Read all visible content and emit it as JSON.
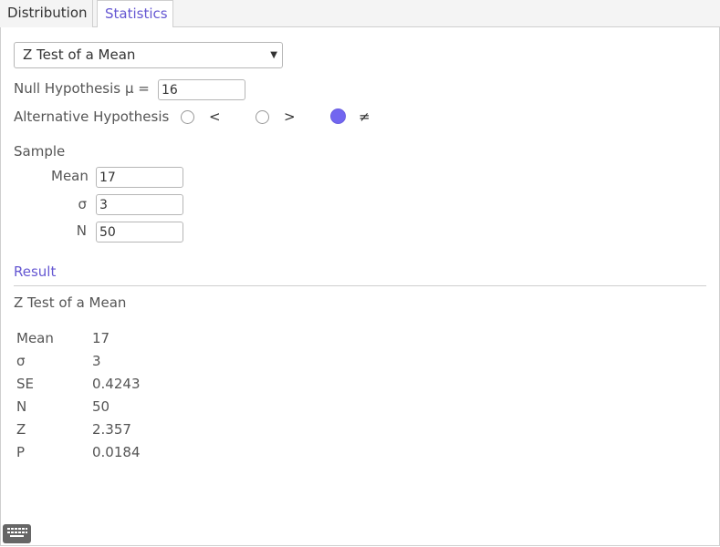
{
  "tabs": [
    {
      "label": "Distribution",
      "active": false
    },
    {
      "label": "Statistics",
      "active": true
    }
  ],
  "procedure": {
    "selected": "Z Test of a Mean"
  },
  "null_hypothesis": {
    "label": "Null Hypothesis",
    "symbol": "μ =",
    "value": "16"
  },
  "alternative_hypothesis": {
    "label": "Alternative Hypothesis",
    "options": [
      {
        "symbol": "<",
        "selected": false
      },
      {
        "symbol": ">",
        "selected": false
      },
      {
        "symbol": "≠",
        "selected": true
      }
    ]
  },
  "sample": {
    "title": "Sample",
    "fields": [
      {
        "label": "Mean",
        "value": "17"
      },
      {
        "label": "σ",
        "value": "3"
      },
      {
        "label": "N",
        "value": "50"
      }
    ]
  },
  "result": {
    "title": "Result",
    "heading": "Z Test of a Mean",
    "rows": [
      {
        "name": "Mean",
        "value": "17"
      },
      {
        "name": "σ",
        "value": "3"
      },
      {
        "name": "SE",
        "value": "0.4243"
      },
      {
        "name": "N",
        "value": "50"
      },
      {
        "name": "Z",
        "value": "2.357"
      },
      {
        "name": "P",
        "value": "0.0184"
      }
    ]
  },
  "colors": {
    "accent": "#6557d2",
    "radio_selected": "#7266f0"
  },
  "icons": {
    "keyboard": "keyboard-icon",
    "dropdown": "chevron-down-icon"
  }
}
